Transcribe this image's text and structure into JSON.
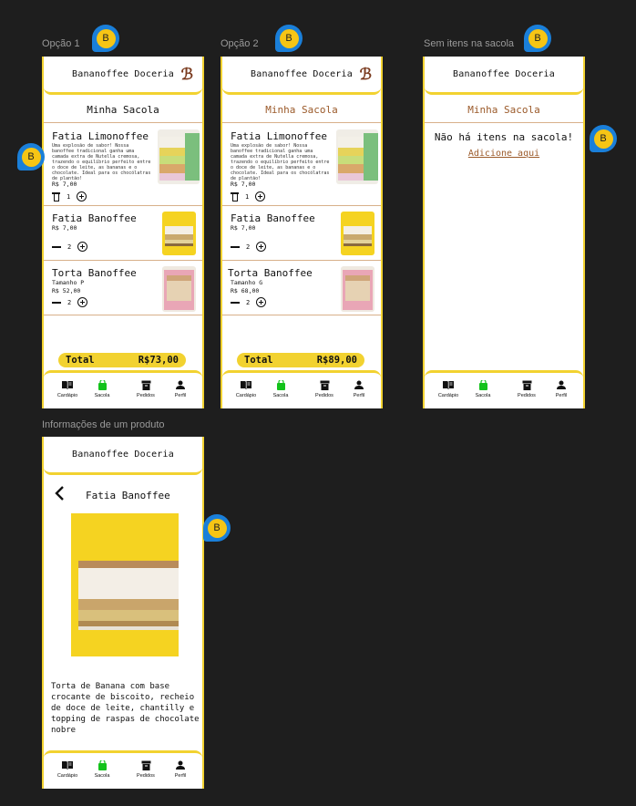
{
  "labels": {
    "option1": "Opção 1",
    "option2": "Opção 2",
    "empty": "Sem itens na sacola",
    "product_info": "Informações de um produto"
  },
  "badge_letter": "B",
  "brand": "Bananoffee Doceria",
  "bag_title": "Minha Sacola",
  "option1": {
    "items": [
      {
        "name": "Fatia Limonoffee",
        "desc": "Uma explosão de sabor! Nossa banoffee tradicional ganha uma camada extra de Nutella cremosa, trazendo o equilíbrio perfeito entre o doce de leite, as bananas e o chocolate. Ideal para os chocólatras de plantão!",
        "price": "R$ 7,00",
        "qty": "1"
      },
      {
        "name": "Fatia Banoffee",
        "price": "R$ 7,00",
        "qty": "2"
      },
      {
        "name": "Torta Banoffee",
        "size": "Tamanho P",
        "price": "R$ 52,00",
        "qty": "2"
      }
    ],
    "total_label": "Total",
    "total_value": "R$73,00"
  },
  "option2": {
    "items": [
      {
        "name": "Fatia Limonoffee",
        "desc": "Uma explosão de sabor! Nossa banoffee tradicional ganha uma camada extra de Nutella cremosa, trazendo o equilíbrio perfeito entre o doce de leite, as bananas e o chocolate. Ideal para os chocólatras de plantão!",
        "price": "R$ 7,00",
        "qty": "1"
      },
      {
        "name": "Fatia Banoffee",
        "price": "R$ 7,00",
        "qty": "2"
      },
      {
        "name": "Torta Banoffee",
        "size": "Tamanho G",
        "price": "R$ 68,00",
        "qty": "2"
      }
    ],
    "total_label": "Total",
    "total_value": "R$89,00"
  },
  "empty_bag": {
    "message": "Não há itens na sacola!",
    "link": "Adicione aqui"
  },
  "product": {
    "title": "Fatia Banoffee",
    "description": "Torta de Banana com base crocante de biscoito, recheio de doce de leite, chantilly e topping de raspas de chocolate nobre"
  },
  "nav": [
    {
      "label": "Cardápio",
      "icon": "menu-book-icon"
    },
    {
      "label": "Sacola",
      "icon": "shopping-bag-icon",
      "active": true
    },
    {
      "label": "Pedidos",
      "icon": "orders-box-icon"
    },
    {
      "label": "Perfil",
      "icon": "person-icon"
    }
  ],
  "colors": {
    "accent": "#f2d230",
    "active_nav": "#13c21b",
    "brand_brown": "#9b5a2a",
    "badge_blue": "#1a7fd9",
    "badge_yellow": "#f6c515"
  }
}
